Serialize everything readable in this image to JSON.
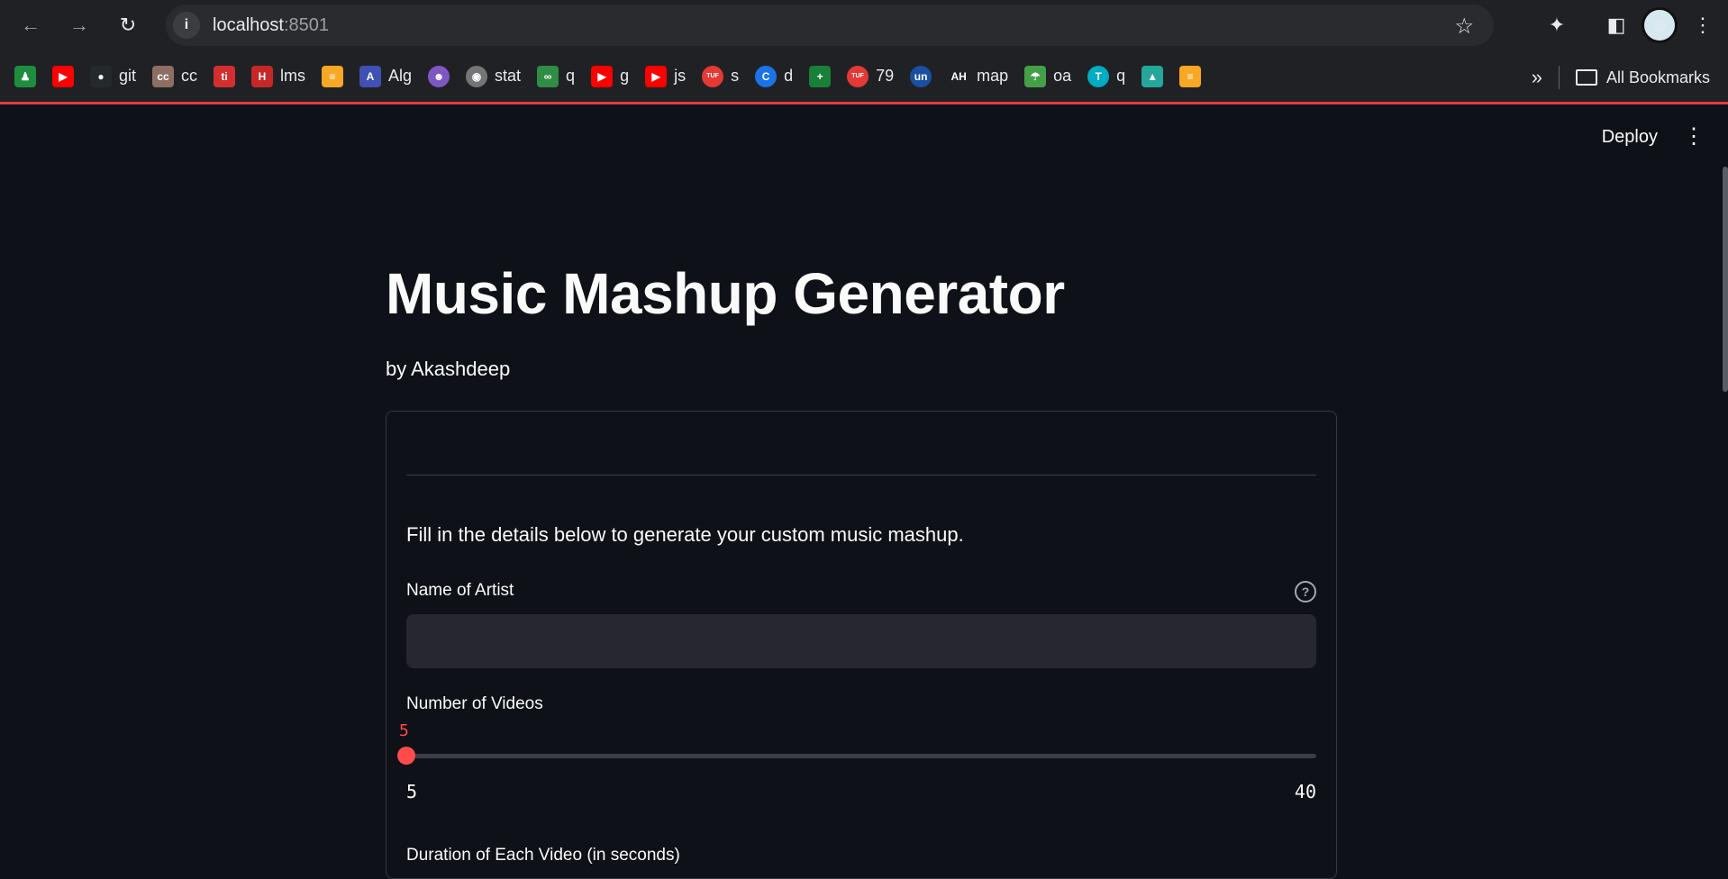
{
  "browser": {
    "url_host": "localhost",
    "url_port": ":8501",
    "bookmarks": [
      {
        "icon": "chess-pawn-icon",
        "label": "",
        "color": "#1e8e3e"
      },
      {
        "icon": "youtube-icon",
        "label": "",
        "color": "#ff0000"
      },
      {
        "icon": "github-icon",
        "label": "git",
        "color": "#24292e"
      },
      {
        "icon": "cc-icon",
        "label": "cc",
        "color": "#8d6e63"
      },
      {
        "icon": "red-logo-icon",
        "label": "",
        "color": "#d32f2f"
      },
      {
        "icon": "lms-icon",
        "label": "lms",
        "color": "#c62828"
      },
      {
        "icon": "layers-icon",
        "label": "",
        "color": "#f9a825"
      },
      {
        "icon": "alg-icon",
        "label": "Alg",
        "color": "#3f51b5"
      },
      {
        "icon": "avatar-icon",
        "label": "",
        "color": "#7e57c2"
      },
      {
        "icon": "globe-icon",
        "label": "stat",
        "color": "#757575"
      },
      {
        "icon": "gfg-icon",
        "label": "q",
        "color": "#2f8d46"
      },
      {
        "icon": "youtube-icon",
        "label": "g",
        "color": "#ff0000"
      },
      {
        "icon": "youtube-icon",
        "label": "js",
        "color": "#ff0000"
      },
      {
        "icon": "tuf-icon",
        "label": "s",
        "color": "#e53935"
      },
      {
        "icon": "c-icon",
        "label": "d",
        "color": "#1a73e8"
      },
      {
        "icon": "plus-sheet-icon",
        "label": "",
        "color": "#188038"
      },
      {
        "icon": "tuf-icon",
        "label": "79",
        "color": "#e53935"
      },
      {
        "icon": "un-icon",
        "label": "",
        "color": "#1a4fa0"
      },
      {
        "icon": "ah-icon",
        "label": "map",
        "color": "#202124"
      },
      {
        "icon": "umbrella-icon",
        "label": "oa",
        "color": "#43a047"
      },
      {
        "icon": "t-icon",
        "label": "q",
        "color": "#00acc1"
      },
      {
        "icon": "mountain-icon",
        "label": "",
        "color": "#26a69a"
      },
      {
        "icon": "layers-icon",
        "label": "",
        "color": "#f9a825"
      }
    ],
    "all_bookmarks_label": "All Bookmarks"
  },
  "app": {
    "deploy_label": "Deploy",
    "title": "Music Mashup Generator",
    "byline": "by Akashdeep",
    "intro": "Fill in the details below to generate your custom music mashup.",
    "artist_label": "Name of Artist",
    "artist_value": "",
    "videos_label": "Number of Videos",
    "videos_value": "5",
    "videos_min": "5",
    "videos_max": "40",
    "videos_fraction": 0,
    "duration_label": "Duration of Each Video (in seconds)",
    "accent_color": "#ff4b4b"
  }
}
